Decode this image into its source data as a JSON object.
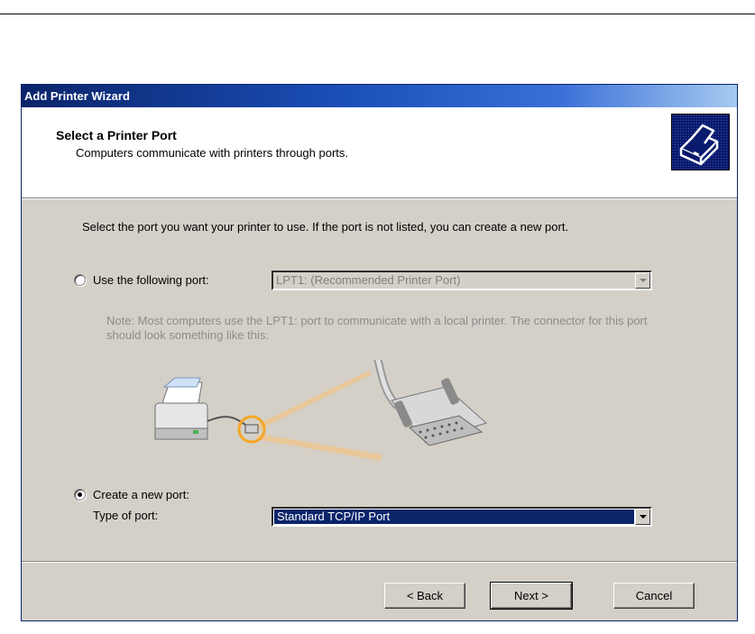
{
  "window": {
    "title": "Add Printer Wizard"
  },
  "header": {
    "title": "Select a Printer Port",
    "subtitle": "Computers communicate with printers through ports.",
    "icon": "printer-wizard-icon"
  },
  "intro_text": "Select the port you want your printer to use.  If the port is not listed, you can create a new port.",
  "option_existing": {
    "label": "Use the following port:",
    "checked": false,
    "combo_value": "LPT1: (Recommended Printer Port)",
    "enabled": false
  },
  "note_text": "Note: Most computers use the LPT1: port to communicate with a local printer. The connector for this port should look something like this:",
  "option_new": {
    "label": "Create a new port:",
    "checked": true,
    "type_label": "Type of port:",
    "combo_value": "Standard TCP/IP Port"
  },
  "buttons": {
    "back": "< Back",
    "next": "Next >",
    "cancel": "Cancel"
  },
  "colors": {
    "title_bar": "#0a246a",
    "dialog_bg": "#d4d0c8",
    "highlight": "#f5a623"
  }
}
